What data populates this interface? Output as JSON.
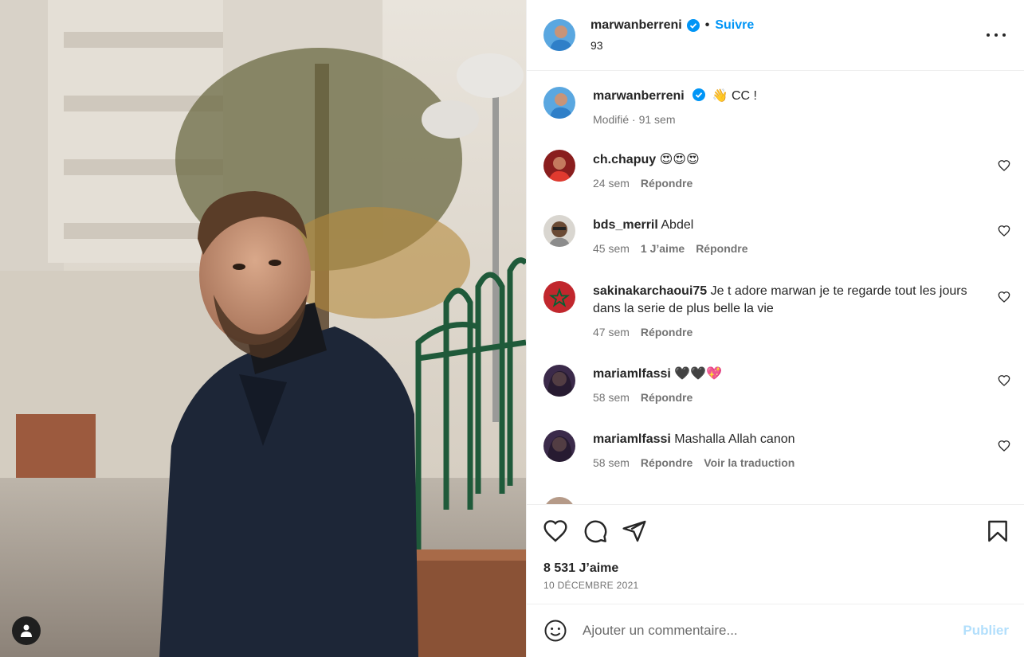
{
  "colors": {
    "accent": "#0095f6",
    "text": "#262626",
    "muted": "#737373",
    "publish_disabled": "#b2dffc"
  },
  "post": {
    "author": "marwanberreni",
    "follow_label": "Suivre",
    "header_sub": "93",
    "caption_text": "👋 CC !",
    "caption_meta": "Modifié · 91 sem"
  },
  "comments": [
    {
      "user": "ch.chapuy",
      "text": "😍😍😍",
      "time": "24 sem",
      "likes": "",
      "reply": "Répondre",
      "translate": ""
    },
    {
      "user": "bds_merril",
      "text": "Abdel",
      "time": "45 sem",
      "likes": "1 J’aime",
      "reply": "Répondre",
      "translate": ""
    },
    {
      "user": "sakinakarchaoui75",
      "text": "Je t adore marwan je te regarde tout les jours dans la serie de plus belle la vie",
      "time": "47 sem",
      "likes": "",
      "reply": "Répondre",
      "translate": ""
    },
    {
      "user": "mariamlfassi",
      "text": "🖤🖤💖",
      "time": "58 sem",
      "likes": "",
      "reply": "Répondre",
      "translate": ""
    },
    {
      "user": "mariamlfassi",
      "text": "Mashalla Allah canon",
      "time": "58 sem",
      "likes": "",
      "reply": "Répondre",
      "translate": "Voir la traduction"
    }
  ],
  "stats": {
    "likes": "8 531 J’aime",
    "date": "10 DÉCEMBRE 2021"
  },
  "composer": {
    "placeholder": "Ajouter un commentaire...",
    "publish_label": "Publier"
  },
  "icons": {
    "like": "heart-icon",
    "comment": "comment-icon",
    "share": "send-icon",
    "save": "bookmark-icon",
    "emoji": "emoji-icon",
    "more": "more-options-icon",
    "verified": "verified-badge-icon",
    "user": "user-icon"
  }
}
